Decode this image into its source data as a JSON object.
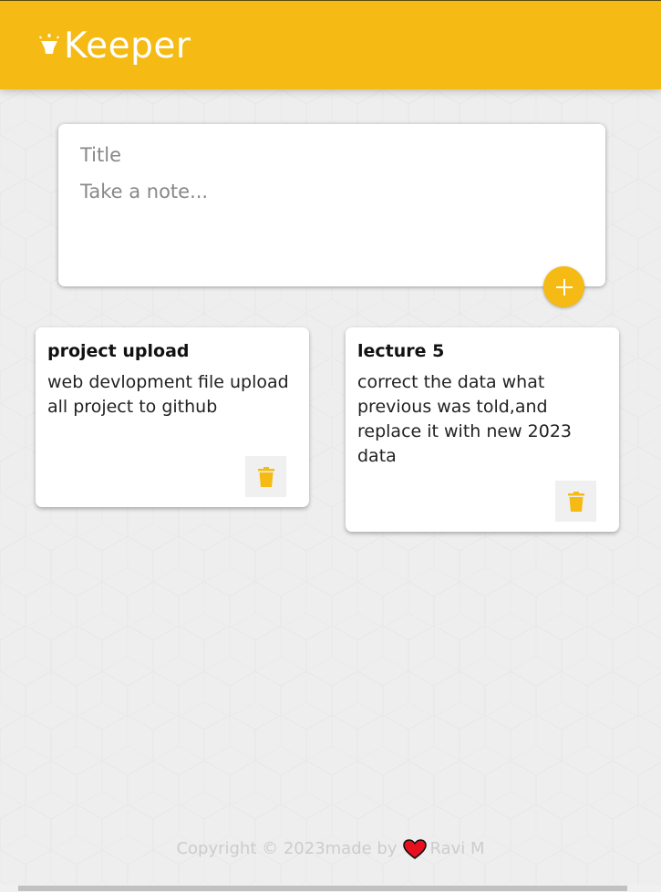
{
  "header": {
    "brand": "Keeper",
    "logo_icon": "lamp-icon",
    "color": "#f5ba13"
  },
  "composer": {
    "title_placeholder": "Title",
    "content_placeholder": "Take a note...",
    "title_value": "",
    "content_value": "",
    "add_icon": "plus-icon"
  },
  "notes": [
    {
      "title": "project upload",
      "content": "web devlopment file upload all project to github",
      "delete_icon": "trash-icon"
    },
    {
      "title": "lecture 5",
      "content": "correct the data what previous was told,and replace it with new 2023 data",
      "delete_icon": "trash-icon"
    }
  ],
  "footer": {
    "copyright": "Copyright © 2023made by",
    "author": "Ravi M",
    "heart_icon": "heart-icon"
  },
  "colors": {
    "accent": "#f5ba13",
    "background": "#eeeeee",
    "card": "#ffffff"
  }
}
